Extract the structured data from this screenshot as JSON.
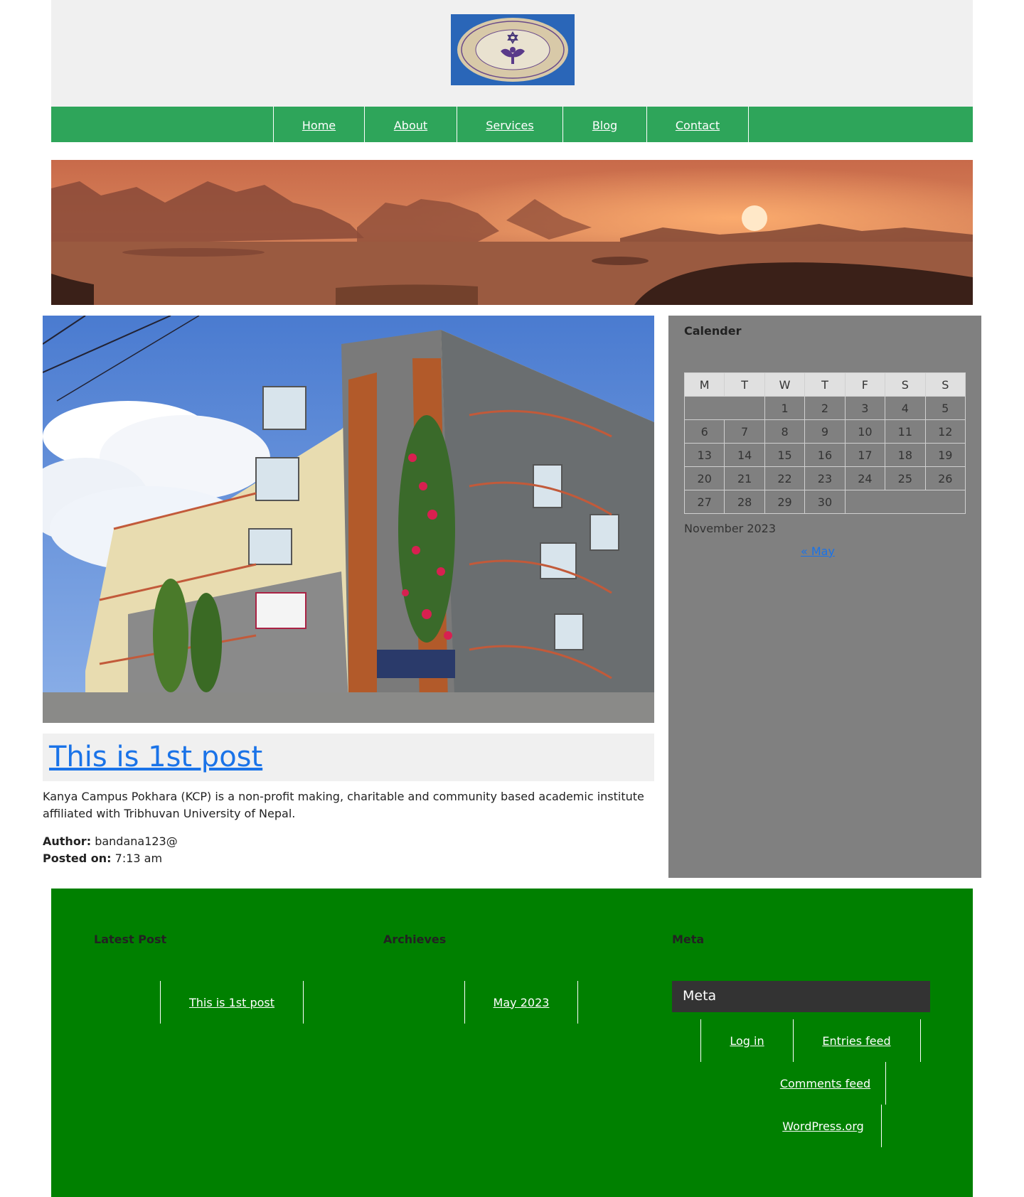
{
  "header": {
    "logo_alt_text": "Tribhuvan University Kanya Campus logo",
    "logo_lettering": "TRIBHUVAN UNIVERSITY KANYA (GIRLS) CAMPUS, POKHARA, NEPAL"
  },
  "nav": {
    "items": [
      {
        "label": "Home"
      },
      {
        "label": "About"
      },
      {
        "label": "Services"
      },
      {
        "label": "Blog"
      },
      {
        "label": "Contact"
      }
    ]
  },
  "post": {
    "title": "This is 1st post",
    "excerpt": "Kanya Campus Pokhara (KCP) is a non-profit making, charitable and community based academic institute affiliated with Tribhuvan University of Nepal.",
    "author_label": "Author:",
    "author": "bandana123@",
    "posted_label": "Posted on:",
    "posted_time": "7:13 am"
  },
  "sidebar": {
    "title": "Calender",
    "calendar": {
      "weekdays": [
        "M",
        "T",
        "W",
        "T",
        "F",
        "S",
        "S"
      ],
      "weeks": [
        [
          "",
          "",
          "1",
          "2",
          "3",
          "4",
          "5"
        ],
        [
          "6",
          "7",
          "8",
          "9",
          "10",
          "11",
          "12"
        ],
        [
          "13",
          "14",
          "15",
          "16",
          "17",
          "18",
          "19"
        ],
        [
          "20",
          "21",
          "22",
          "23",
          "24",
          "25",
          "26"
        ],
        [
          "27",
          "28",
          "29",
          "30",
          "",
          "",
          ""
        ]
      ],
      "caption": "November 2023",
      "prev_link": "« May"
    }
  },
  "footer": {
    "latest_heading": "Latest Post",
    "latest_link": "This is 1st post",
    "archives_heading": "Archieves",
    "archives_link": "May 2023",
    "meta_heading": "Meta",
    "meta_bar_title": "Meta",
    "meta_links": {
      "login": "Log in",
      "entries": "Entries feed",
      "comments": "Comments feed",
      "wordpress": "WordPress.org"
    }
  },
  "colors": {
    "nav_bg": "#2ea55a",
    "footer_bg": "#008000",
    "sidebar_bg": "#808080",
    "link": "#1a73e8"
  }
}
